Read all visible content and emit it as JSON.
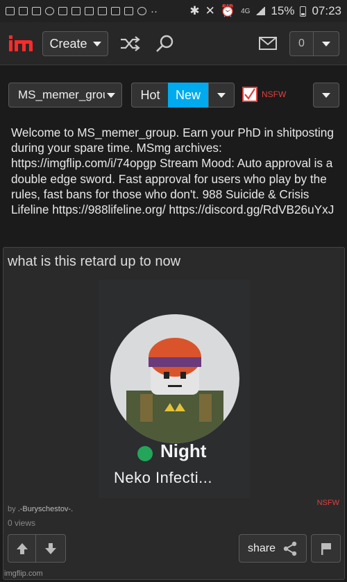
{
  "status_bar": {
    "network": "4G",
    "battery": "15%",
    "time": "07:23"
  },
  "nav": {
    "create_label": "Create",
    "notification_count": "0"
  },
  "stream": {
    "selected_stream": "MS_memer_group",
    "sort_hot": "Hot",
    "sort_new": "New",
    "nsfw_label": "NSFW",
    "description": "Welcome to MS_memer_group. Earn your PhD in shitposting during your spare time. MSmg archives: https://imgflip.com/i/74opgp Stream Mood: Auto approval is a double edge sword. Fast approval for users who play by the rules, fast bans for those who don't. 988 Suicide & Crisis Lifeline https://988lifeline.org/ https://discord.gg/RdVB26uYxJ"
  },
  "post": {
    "title": "what is this retard up to now",
    "image_name": "Night",
    "image_status": "Neko Infecti...",
    "nsfw_label": "NSFW",
    "by_label": "by",
    "author": ".-Buryschestov-.",
    "views": "0 views",
    "share_label": "share"
  },
  "footer": "imgflip.com",
  "colors": {
    "accent": "#00aaee",
    "nsfw_red": "#e04040",
    "online_green": "#23a55a"
  }
}
